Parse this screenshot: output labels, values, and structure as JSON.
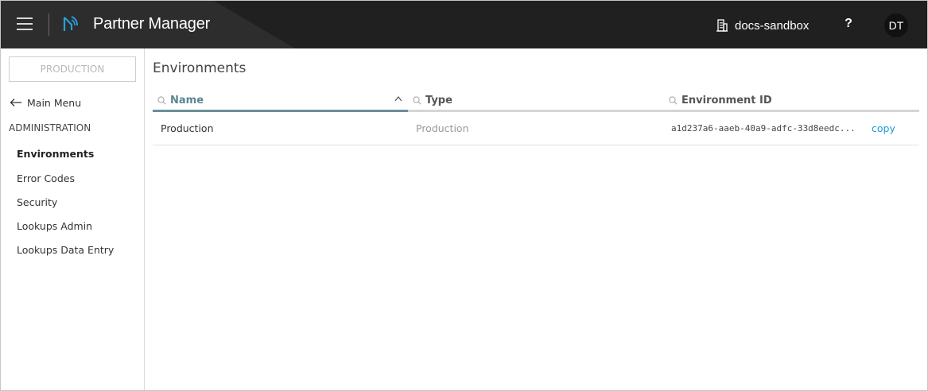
{
  "header": {
    "app_title": "Partner Manager",
    "org_name": "docs-sandbox",
    "help_label": "?",
    "avatar_initials": "DT",
    "bg_color": "#202020"
  },
  "sidebar": {
    "environment_select": "PRODUCTION",
    "main_menu_label": "Main Menu",
    "section_label": "ADMINISTRATION",
    "items": [
      {
        "label": "Environments",
        "active": true
      },
      {
        "label": "Error Codes",
        "active": false
      },
      {
        "label": "Security",
        "active": false
      },
      {
        "label": "Lookups Admin",
        "active": false
      },
      {
        "label": "Lookups Data Entry",
        "active": false
      }
    ]
  },
  "main": {
    "title": "Environments",
    "columns": [
      {
        "label": "Name",
        "sorted": "ascending"
      },
      {
        "label": "Type"
      },
      {
        "label": "Environment ID"
      }
    ],
    "rows": [
      {
        "name": "Production",
        "type": "Production",
        "environment_id": "a1d237a6-aaeb-40a9-adfc-33d8eedc...",
        "copy_label": "copy"
      }
    ],
    "accent_color": "#1a9bd7"
  }
}
